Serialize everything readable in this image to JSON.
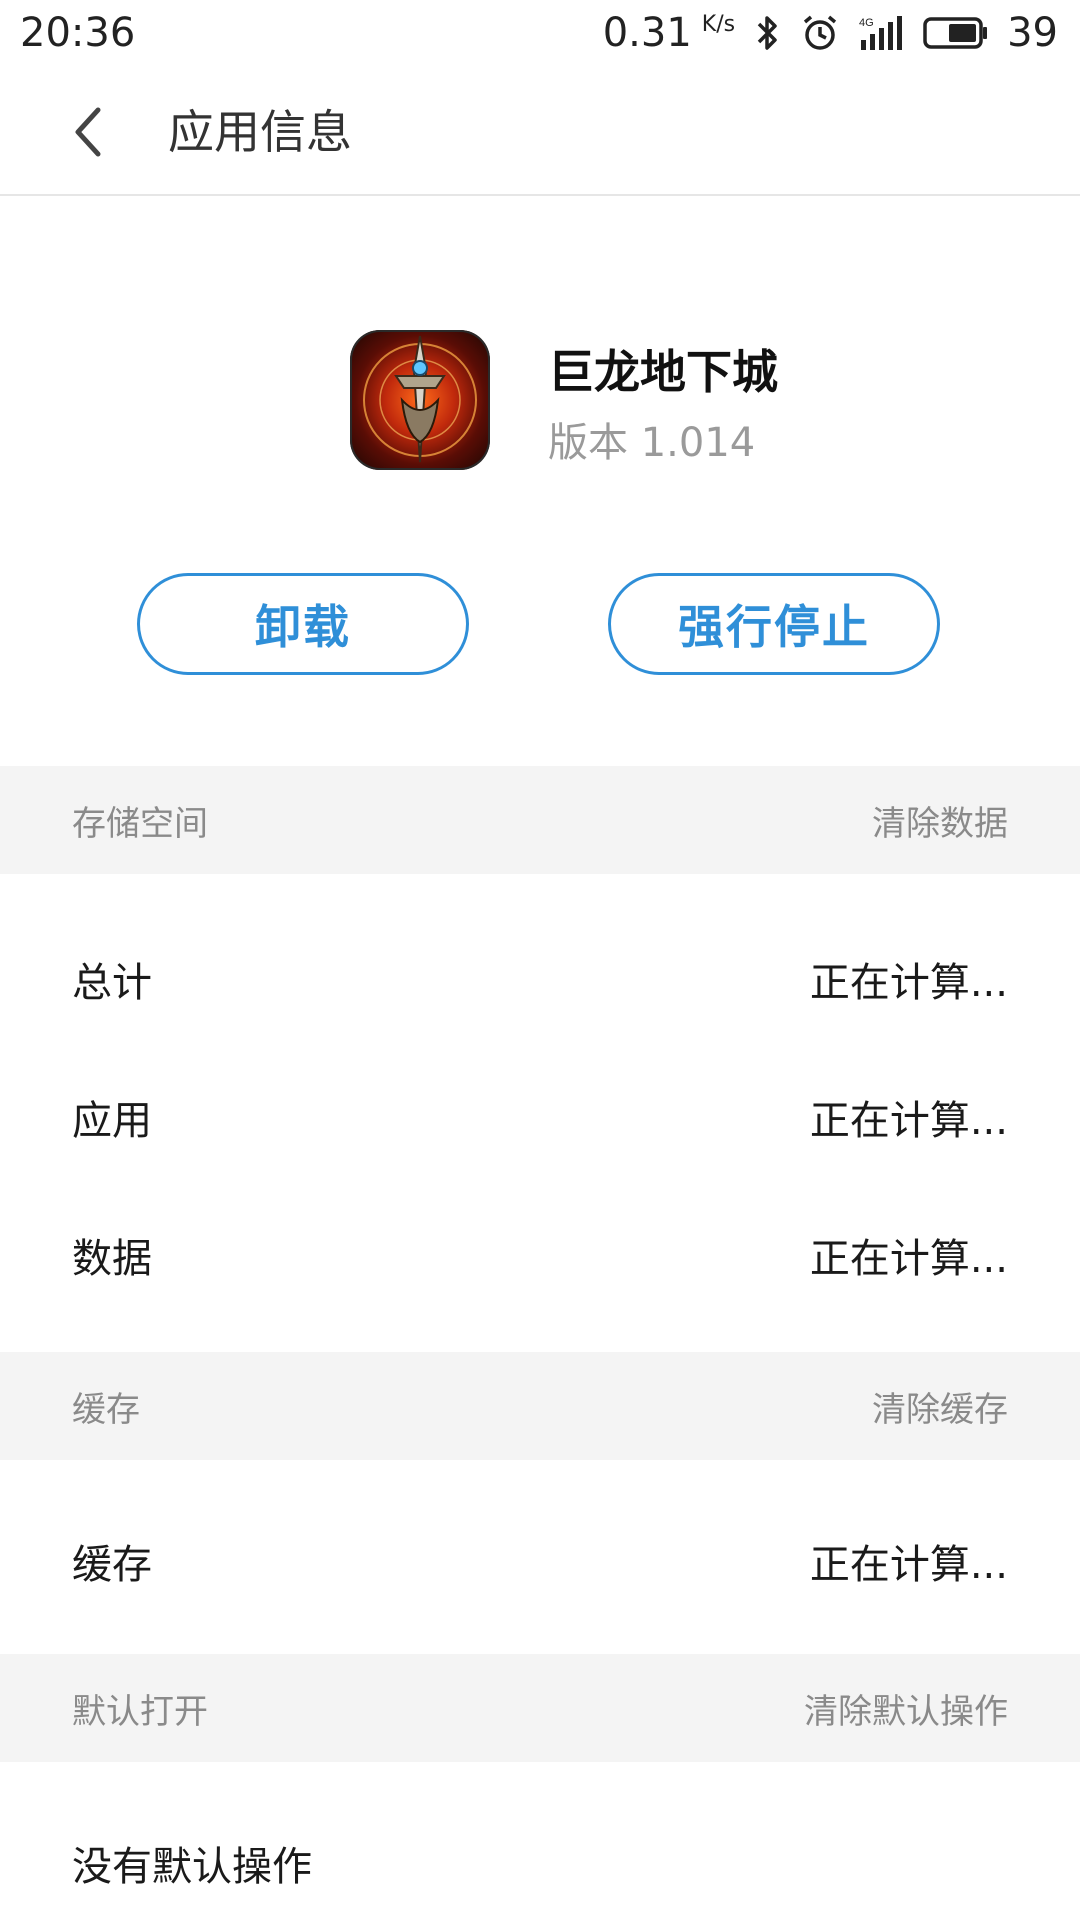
{
  "status_bar": {
    "time": "20:36",
    "net_speed": "0.31",
    "net_unit": "K/s",
    "battery": "39"
  },
  "app_bar": {
    "title": "应用信息"
  },
  "app": {
    "name": "巨龙地下城",
    "version": "版本 1.014"
  },
  "buttons": {
    "uninstall": "卸载",
    "force_stop": "强行停止"
  },
  "storage": {
    "title": "存储空间",
    "action": "清除数据",
    "rows": [
      {
        "label": "总计",
        "value": "正在计算..."
      },
      {
        "label": "应用",
        "value": "正在计算..."
      },
      {
        "label": "数据",
        "value": "正在计算..."
      }
    ]
  },
  "cache": {
    "title": "缓存",
    "action": "清除缓存",
    "rows": [
      {
        "label": "缓存",
        "value": "正在计算..."
      }
    ]
  },
  "default_open": {
    "title": "默认打开",
    "action": "清除默认操作",
    "rows": [
      {
        "label": "没有默认操作"
      }
    ]
  },
  "colors": {
    "accent": "#2f8fd8",
    "section_bg": "#f4f4f4"
  }
}
